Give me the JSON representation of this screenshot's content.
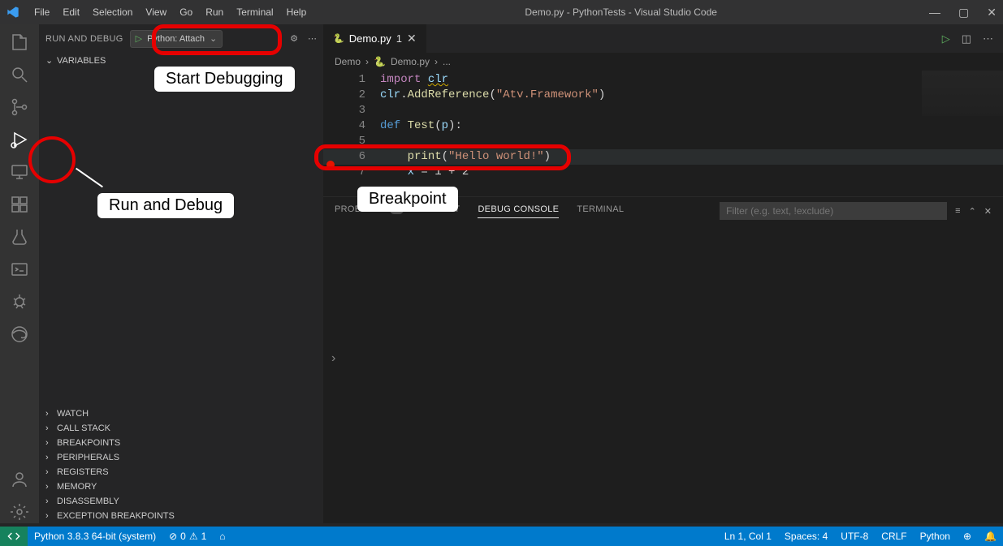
{
  "titlebar": {
    "menus": [
      "File",
      "Edit",
      "Selection",
      "View",
      "Go",
      "Run",
      "Terminal",
      "Help"
    ],
    "title": "Demo.py - PythonTests - Visual Studio Code"
  },
  "sidebar": {
    "title": "RUN AND DEBUG",
    "config_label": "Python: Attach",
    "sections_top": [
      "VARIABLES"
    ],
    "sections_bottom": [
      "WATCH",
      "CALL STACK",
      "BREAKPOINTS",
      "PERIPHERALS",
      "REGISTERS",
      "MEMORY",
      "DISASSEMBLY",
      "EXCEPTION BREAKPOINTS"
    ]
  },
  "tab": {
    "filename": "Demo.py",
    "dirty_marker": "1"
  },
  "breadcrumbs": {
    "folder": "Demo",
    "file": "Demo.py",
    "tail": "..."
  },
  "code": {
    "lines": [
      {
        "n": "1",
        "bp": false,
        "html": "<span class='kw'>import</span> <span class='var underline-warn'>clr</span>"
      },
      {
        "n": "2",
        "bp": false,
        "html": "<span class='var'>clr</span><span class='pln'>.</span><span class='fn'>AddReference</span><span class='pln'>(</span><span class='str'>\"Atv.Framework\"</span><span class='pln'>)</span>"
      },
      {
        "n": "3",
        "bp": false,
        "html": ""
      },
      {
        "n": "4",
        "bp": false,
        "html": "<span class='kw2'>def</span> <span class='fn'>Test</span><span class='pln'>(</span><span class='var'>p</span><span class='pln'>):</span>"
      },
      {
        "n": "5",
        "bp": false,
        "html": ""
      },
      {
        "n": "6",
        "bp": true,
        "hl": true,
        "html": "    <span class='fn'>print</span><span class='pln'>(</span><span class='str'>\"Hello world!\"</span><span class='pln'>)</span>"
      },
      {
        "n": "7",
        "bp": false,
        "html": "    <span class='var'>x</span> <span class='pln'>=</span> <span class='pln'>1 + 2</span>"
      }
    ]
  },
  "panel": {
    "tabs": {
      "problems": "PROBLEMS",
      "problems_count": "1",
      "output": "OUTPUT",
      "debug_console": "DEBUG CONSOLE",
      "terminal": "TERMINAL"
    },
    "filter_placeholder": "Filter (e.g. text, !exclude)",
    "prompt": "›"
  },
  "statusbar": {
    "interpreter": "Python 3.8.3 64-bit (system)",
    "errors": "0",
    "warnings": "1",
    "position": "Ln 1, Col 1",
    "spaces": "Spaces: 4",
    "encoding": "UTF-8",
    "eol": "CRLF",
    "language": "Python"
  },
  "annotations": {
    "start_debugging": "Start Debugging",
    "run_and_debug": "Run and Debug",
    "breakpoint": "Breakpoint"
  }
}
